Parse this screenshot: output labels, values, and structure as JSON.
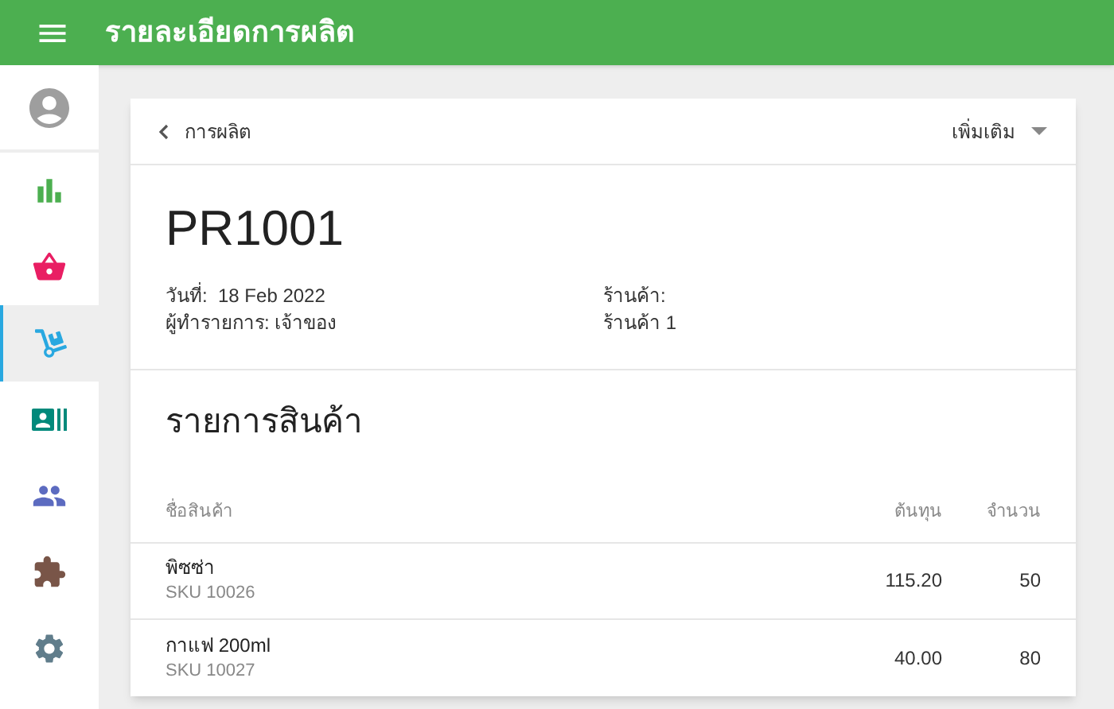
{
  "app_bar": {
    "title": "รายละเอียดการผลิต"
  },
  "sidebar": {
    "items": [
      {
        "kind": "profile",
        "selected": false
      },
      {
        "kind": "chart",
        "selected": false
      },
      {
        "kind": "basket",
        "selected": false
      },
      {
        "kind": "dolly",
        "selected": true
      },
      {
        "kind": "contact",
        "selected": false
      },
      {
        "kind": "people",
        "selected": false
      },
      {
        "kind": "puzzle",
        "selected": false
      },
      {
        "kind": "settings",
        "selected": false
      }
    ]
  },
  "card": {
    "back_label": "การผลิต",
    "more_label": "เพิ่มเติม",
    "code": "PR1001",
    "info_left": [
      "วันที่:  18 Feb 2022",
      "ผู้ทำรายการ: เจ้าของ"
    ],
    "info_right": [
      "ร้านค้า:",
      "ร้านค้า 1"
    ],
    "section_title": "รายการสินค้า",
    "columns": [
      "ชื่อสินค้า",
      "ต้นทุน",
      "จำนวน"
    ],
    "rows": [
      {
        "name": "พิซซ่า",
        "sku": "SKU 10026",
        "cost": "115.20",
        "qty": "50"
      },
      {
        "name": "กาแฟ 200ml",
        "sku": "SKU 10027",
        "cost": "40.00",
        "qty": "80"
      }
    ]
  }
}
